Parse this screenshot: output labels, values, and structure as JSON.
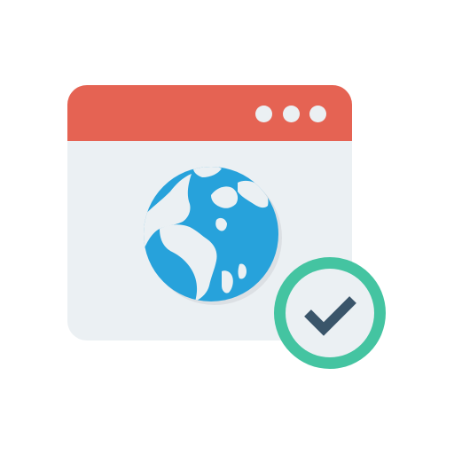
{
  "colors": {
    "title_bar": "#E56353",
    "window_body": "#EBF0F3",
    "window_dot": "#EBF0F3",
    "globe_ocean": "#27A2DB",
    "globe_shadow": "#DCE0E4",
    "globe_land": "#EBF0F3",
    "badge_ring": "#44C4A1",
    "badge_fill": "#EBF0F3",
    "checkmark": "#3A556A"
  },
  "icons": {
    "window": "browser-window-icon",
    "globe": "globe-icon",
    "badge": "checkmark-icon"
  }
}
